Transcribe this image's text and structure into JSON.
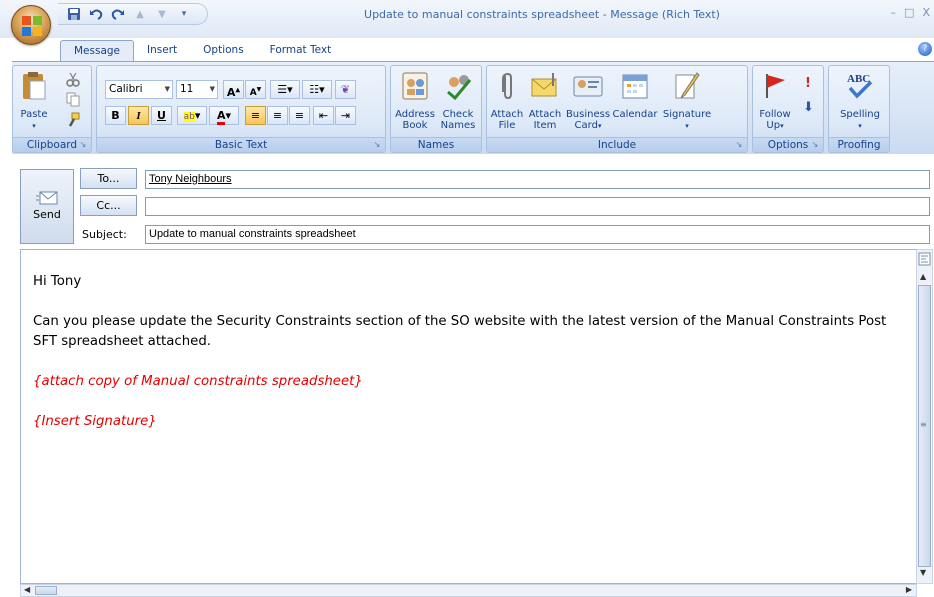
{
  "window": {
    "title": "Update to manual constraints spreadsheet - Message (Rich Text)",
    "controls": [
      "–",
      "□",
      "X"
    ]
  },
  "tabs": [
    "Message",
    "Insert",
    "Options",
    "Format Text"
  ],
  "ribbon": {
    "clipboard": {
      "label": "Clipboard",
      "paste": "Paste"
    },
    "basic_text": {
      "label": "Basic Text",
      "font": "Calibri",
      "size": "11",
      "bold": "B",
      "italic": "I",
      "underline": "U"
    },
    "names": {
      "label": "Names",
      "address_book": "Address Book",
      "check_names": "Check Names"
    },
    "include": {
      "label": "Include",
      "attach_file": "Attach File",
      "attach_item": "Attach Item",
      "business_card": "Business Card",
      "calendar": "Calendar",
      "signature": "Signature"
    },
    "options": {
      "label": "Options",
      "follow_up": "Follow Up"
    },
    "proofing": {
      "label": "Proofing",
      "spelling": "Spelling",
      "abc": "ABC"
    }
  },
  "header": {
    "send": "Send",
    "to_button": "To...",
    "cc_button": "Cc...",
    "subject_label": "Subject:",
    "to_value": "Tony Neighbours",
    "cc_value": "",
    "subject_value": "Update to manual constraints spreadsheet"
  },
  "body": {
    "greeting": "Hi Tony",
    "paragraph": "Can you please update the Security Constraints section of the SO website with the latest version of the Manual Constraints Post SFT spreadsheet attached.",
    "attach_note": "{attach copy of Manual constraints spreadsheet}",
    "signature_note": "{Insert Signature}"
  },
  "colors": {
    "accent": "#15428b",
    "ribbon": "#dbe6f5",
    "placeholder_red": "#e60000"
  }
}
